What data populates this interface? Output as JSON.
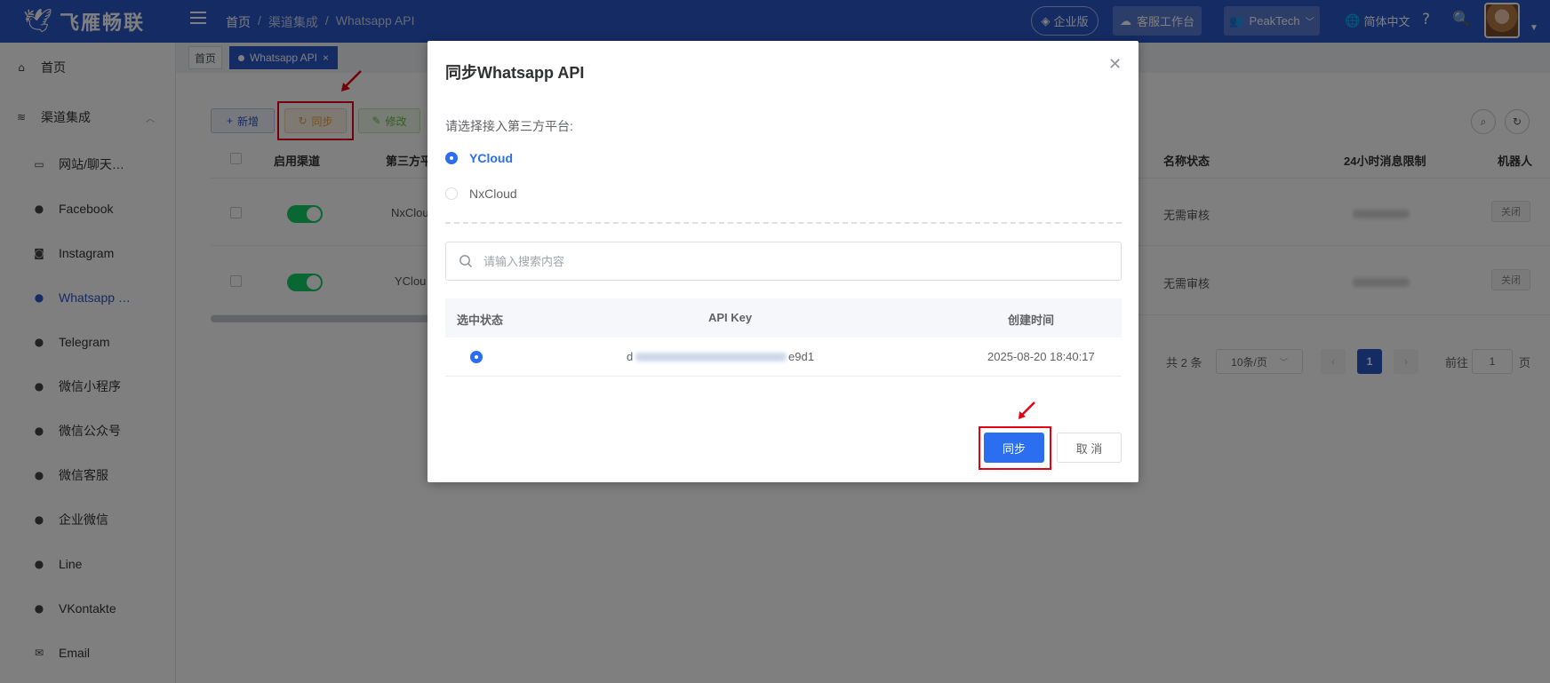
{
  "topbar": {
    "logo_text": "飞雁畅联",
    "breadcrumb": [
      "首页",
      "/",
      "渠道集成",
      "/",
      "Whatsapp API"
    ],
    "enterprise_label": "企业版",
    "service_label": "客服工作台",
    "account_label": "PeakTech",
    "language_label": "简体中文"
  },
  "sidebar": {
    "items": [
      {
        "label": "首页"
      },
      {
        "label": "渠道集成"
      },
      {
        "label": "网站/聊天…"
      },
      {
        "label": "Facebook"
      },
      {
        "label": "Instagram"
      },
      {
        "label": "Whatsapp …"
      },
      {
        "label": "Telegram"
      },
      {
        "label": "微信小程序"
      },
      {
        "label": "微信公众号"
      },
      {
        "label": "微信客服"
      },
      {
        "label": "企业微信"
      },
      {
        "label": "Line"
      },
      {
        "label": "VKontakte"
      },
      {
        "label": "Email"
      }
    ]
  },
  "tags": {
    "home": "首页",
    "active": "Whatsapp API",
    "active_close": "×"
  },
  "toolbar": {
    "add_label": "新增",
    "sync_label": "同步",
    "edit_label": "修改"
  },
  "table": {
    "headers": [
      "启用渠道",
      "第三方平",
      "名称状态",
      "24小时消息限制",
      "机器人"
    ],
    "rows": [
      {
        "platform": "NxClou",
        "status": "无需审核",
        "robot": "关闭"
      },
      {
        "platform": "YClou",
        "status": "无需审核",
        "robot": "关闭"
      }
    ]
  },
  "pagination": {
    "total": "共 2 条",
    "page_size": "10条/页",
    "current": "1",
    "goto_label": "前往",
    "goto_value": "1",
    "page_unit": "页"
  },
  "modal": {
    "title": "同步Whatsapp API",
    "prompt": "请选择接入第三方平台:",
    "options": [
      {
        "label": "YCloud",
        "selected": true
      },
      {
        "label": "NxCloud",
        "selected": false
      }
    ],
    "search_placeholder": "请输入搜索内容",
    "table_headers": [
      "选中状态",
      "API Key",
      "创建时间"
    ],
    "table_rows": [
      {
        "api_key_prefix": "d",
        "api_key_suffix": "e9d1",
        "created": "2025-08-20 18:40:17"
      }
    ],
    "sync_label": "同步",
    "cancel_label": "取 消"
  },
  "colors": {
    "topbar": "#2b56c9",
    "primary": "#2b6ff0",
    "highlight": "#e60012",
    "switch_on": "#13ce66"
  }
}
